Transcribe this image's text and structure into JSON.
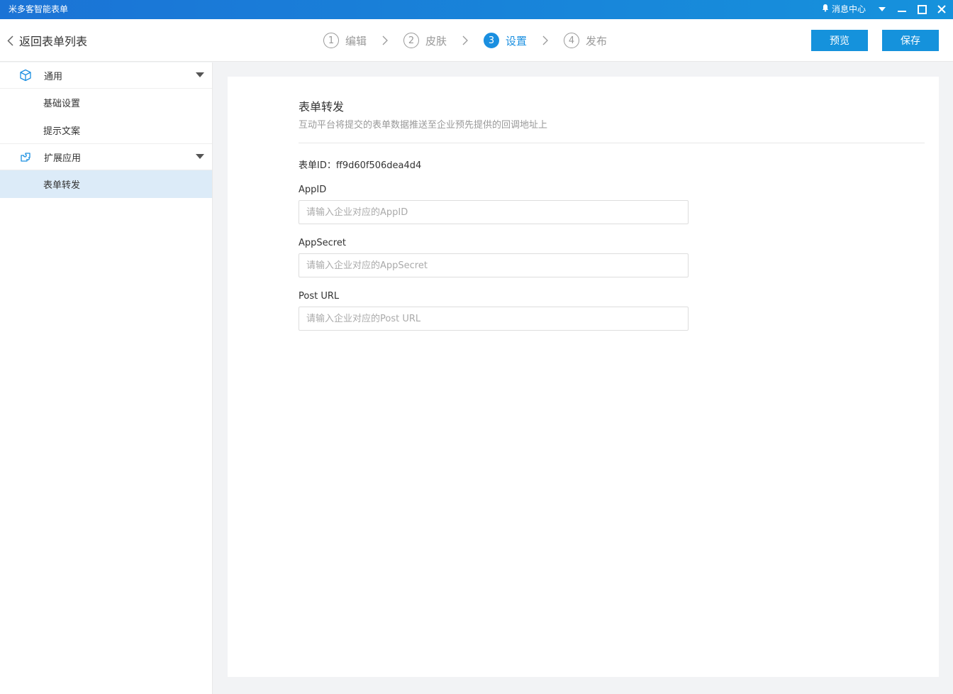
{
  "titlebar": {
    "app_title": "米多客智能表单",
    "message_center": "消息中心"
  },
  "header": {
    "back_label": "返回表单列表",
    "steps": [
      {
        "num": "1",
        "label": "编辑"
      },
      {
        "num": "2",
        "label": "皮肤"
      },
      {
        "num": "3",
        "label": "设置"
      },
      {
        "num": "4",
        "label": "发布"
      }
    ],
    "preview_label": "预览",
    "save_label": "保存"
  },
  "sidebar": {
    "groups": [
      {
        "label": "通用",
        "items": [
          "基础设置",
          "提示文案"
        ]
      },
      {
        "label": "扩展应用",
        "items": [
          "表单转发"
        ]
      }
    ]
  },
  "main": {
    "title": "表单转发",
    "description": "互动平台将提交的表单数据推送至企业预先提供的回调地址上",
    "form_id_label": "表单ID：",
    "form_id_value": "ff9d60f506dea4d4",
    "fields": [
      {
        "label": "AppID",
        "value": "",
        "placeholder": "请输入企业对应的AppID"
      },
      {
        "label": "AppSecret",
        "value": "",
        "placeholder": "请输入企业对应的AppSecret"
      },
      {
        "label": "Post URL",
        "value": "",
        "placeholder": "请输入企业对应的Post URL"
      }
    ]
  },
  "colors": {
    "accent": "#1592dc",
    "active_step": "#1a8fe0",
    "sidebar_active_bg": "#dcebf8"
  },
  "icons": {
    "bell": "bell-icon",
    "dropdown": "chevron-down-icon",
    "minimize": "minimize-icon",
    "maximize": "maximize-icon",
    "close": "close-icon",
    "back": "chevron-left-icon",
    "step_separator": "chevron-right-icon",
    "group_general": "cube-icon",
    "group_extension": "puzzle-icon",
    "group_caret": "caret-down-icon"
  }
}
